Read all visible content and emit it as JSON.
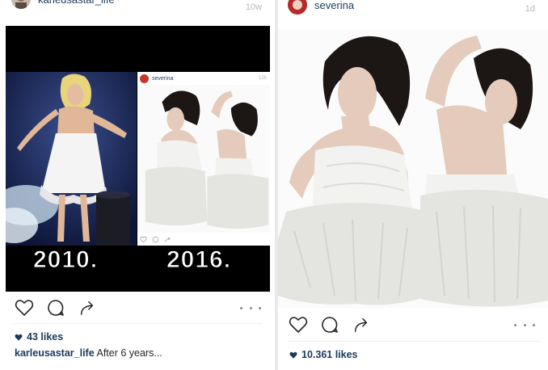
{
  "left_post": {
    "username": "karleusastar_life",
    "time": "10w",
    "image": {
      "year_left": "2010.",
      "year_right": "2016.",
      "inner_post": {
        "username": "severina",
        "time": "12h"
      }
    },
    "likes": "43 likes",
    "caption": {
      "username": "karleusastar_life",
      "text": "After 6 years..."
    }
  },
  "right_post": {
    "username": "severina",
    "time": "1d",
    "likes": "10.361 likes"
  },
  "icons": {
    "like": "heart-outline-icon",
    "comment": "comment-bubble-icon",
    "share": "share-arrow-icon",
    "more": "more-options-icon",
    "likes_badge": "heart-filled-icon"
  },
  "colors": {
    "username": "#1a3a5c",
    "icon": "#262626",
    "background": "#ffffff",
    "stage": "#14244c"
  }
}
